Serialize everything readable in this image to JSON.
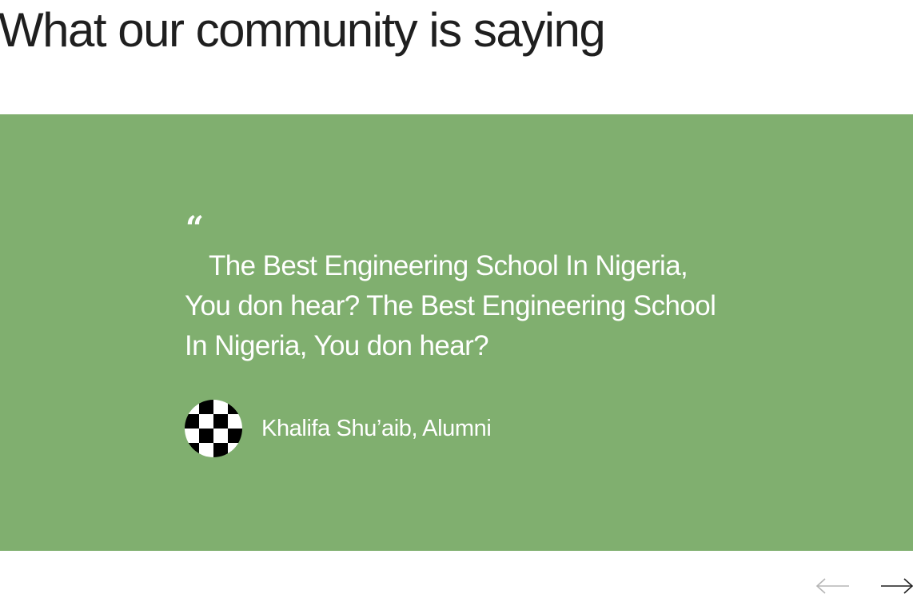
{
  "section": {
    "title": "What our community is saying"
  },
  "testimonial": {
    "quote_mark": "“",
    "quote": "The Best Engineering School In Nigeria, You don hear? The Best Engineering School In Nigeria, You don hear?",
    "author": "Khalifa Shu’aib, Alumni",
    "background_color": "#80af6f"
  },
  "carousel": {
    "prev_icon": "arrow-left-icon",
    "next_icon": "arrow-right-icon",
    "prev_color": "#b5b5b5",
    "next_color": "#1f1f1f"
  }
}
